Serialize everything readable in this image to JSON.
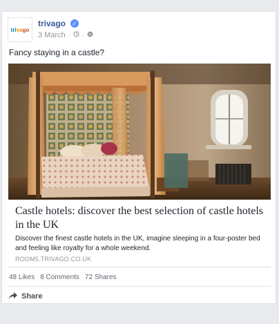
{
  "post": {
    "page_name": "trivago",
    "date": "3 March",
    "separator": "·",
    "text": "Fancy staying in a castle?"
  },
  "logo": {
    "part1": "tri",
    "part2": "va",
    "part3": "go"
  },
  "link": {
    "title": "Castle hotels: discover the best selection of castle hotels in the UK",
    "description": "Discover the finest castle hotels in the UK, imagine sleeping in a four-poster bed and feeling like royalty for a whole weekend.",
    "domain": "ROOM5.TRIVAGO.CO.UK"
  },
  "stats": {
    "likes": "48 Likes",
    "comments": "8 Comments",
    "shares": "72 Shares"
  },
  "actions": {
    "share_label": "Share"
  },
  "icons": {
    "verified": "verified-badge-icon",
    "clock": "clock-icon",
    "globe": "globe-icon",
    "share": "share-arrow-icon"
  },
  "colors": {
    "link_blue": "#365899",
    "verified_blue": "#5890ff",
    "meta_gray": "#90949c"
  }
}
